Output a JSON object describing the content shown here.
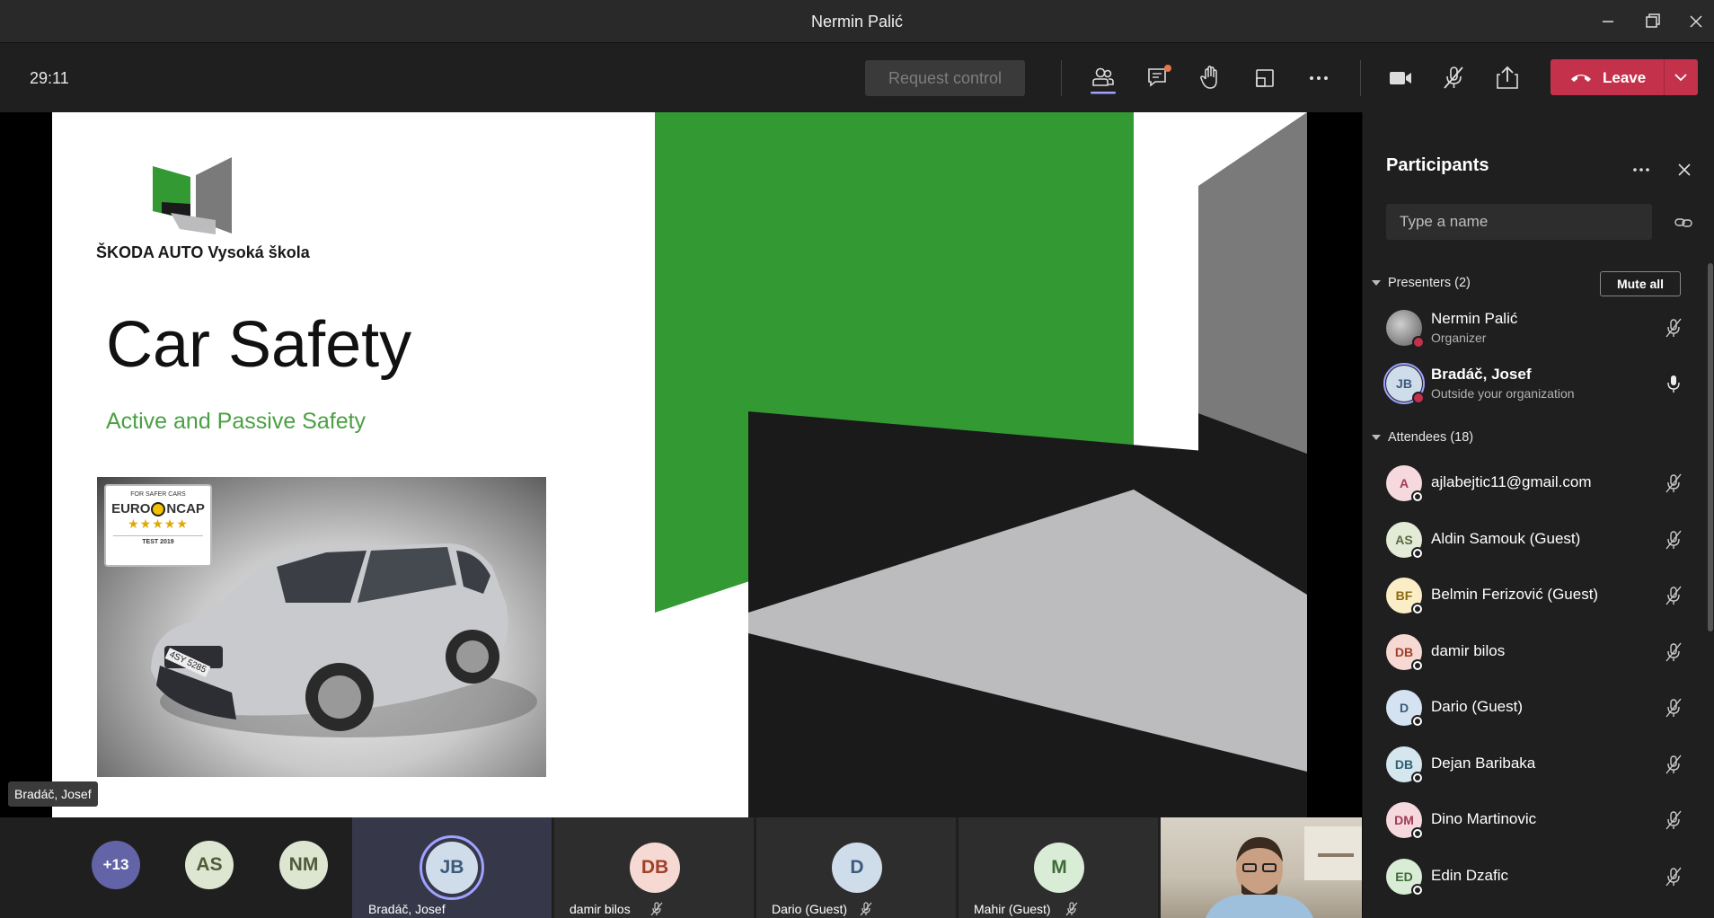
{
  "window": {
    "title": "Nermin Palić"
  },
  "toolbar": {
    "timer": "29:11",
    "request_control": "Request control",
    "leave": "Leave"
  },
  "stage": {
    "presenter_label": "Bradáč, Josef",
    "slide": {
      "logo_text": "ŠKODA AUTO Vysoká škola",
      "title": "Car Safety",
      "subtitle": "Active and Passive Safety",
      "badge": {
        "line1": "FOR SAFER CARS",
        "brand_left": "EURO",
        "brand_right": "NCAP",
        "stars": "★★★★★",
        "test": "TEST 2019"
      },
      "plate": "4SY 5285"
    }
  },
  "strip": {
    "more": "+13",
    "avatars": [
      {
        "initials": "AS",
        "bg": "#dde6d0",
        "fg": "#4d5c3a"
      },
      {
        "initials": "NM",
        "bg": "#dde6d0",
        "fg": "#4d5c3a"
      }
    ],
    "tiles": [
      {
        "initials": "JB",
        "name": "Bradáč, Josef",
        "bg": "#cfdcea",
        "fg": "#3d5a7a"
      },
      {
        "initials": "DB",
        "name": "damir bilos",
        "bg": "#f6d9d2",
        "fg": "#a0402b"
      },
      {
        "initials": "D",
        "name": "Dario (Guest)",
        "bg": "#cfdcea",
        "fg": "#3d5a7a"
      },
      {
        "initials": "M",
        "name": "Mahir (Guest)",
        "bg": "#d9ecd6",
        "fg": "#3f6a38"
      }
    ]
  },
  "participants": {
    "title": "Participants",
    "search_placeholder": "Type a name",
    "mute_all": "Mute all",
    "presenters_label": "Presenters (2)",
    "presenters": [
      {
        "name": "Nermin Palić",
        "sub": "Organizer",
        "initials": "",
        "bg": "#6b6b6b",
        "fg": "#fff",
        "mic": "muted"
      },
      {
        "name": "Bradáč, Josef",
        "sub": "Outside your organization",
        "initials": "JB",
        "bg": "#cfdcea",
        "fg": "#3d5a7a",
        "mic": "on"
      }
    ],
    "attendees_label": "Attendees (18)",
    "attendees": [
      {
        "name": "ajlabejtic11@gmail.com",
        "initials": "A",
        "bg": "#f6d9df",
        "fg": "#a03a55"
      },
      {
        "name": "Aldin Samouk (Guest)",
        "initials": "AS",
        "bg": "#e3ead5",
        "fg": "#5a6a40"
      },
      {
        "name": "Belmin Ferizović (Guest)",
        "initials": "BF",
        "bg": "#fbeec6",
        "fg": "#8a6a10"
      },
      {
        "name": "damir bilos",
        "initials": "DB",
        "bg": "#f6d9d2",
        "fg": "#a0402b"
      },
      {
        "name": "Dario (Guest)",
        "initials": "D",
        "bg": "#d5e2f2",
        "fg": "#3d5a7a"
      },
      {
        "name": "Dejan Baribaka",
        "initials": "DB",
        "bg": "#d5e6ee",
        "fg": "#2f5f73"
      },
      {
        "name": "Dino Martinovic",
        "initials": "DM",
        "bg": "#f6d9df",
        "fg": "#a03a55"
      },
      {
        "name": "Edin Dzafic",
        "initials": "ED",
        "bg": "#d9ecd6",
        "fg": "#3f6a38"
      }
    ]
  }
}
